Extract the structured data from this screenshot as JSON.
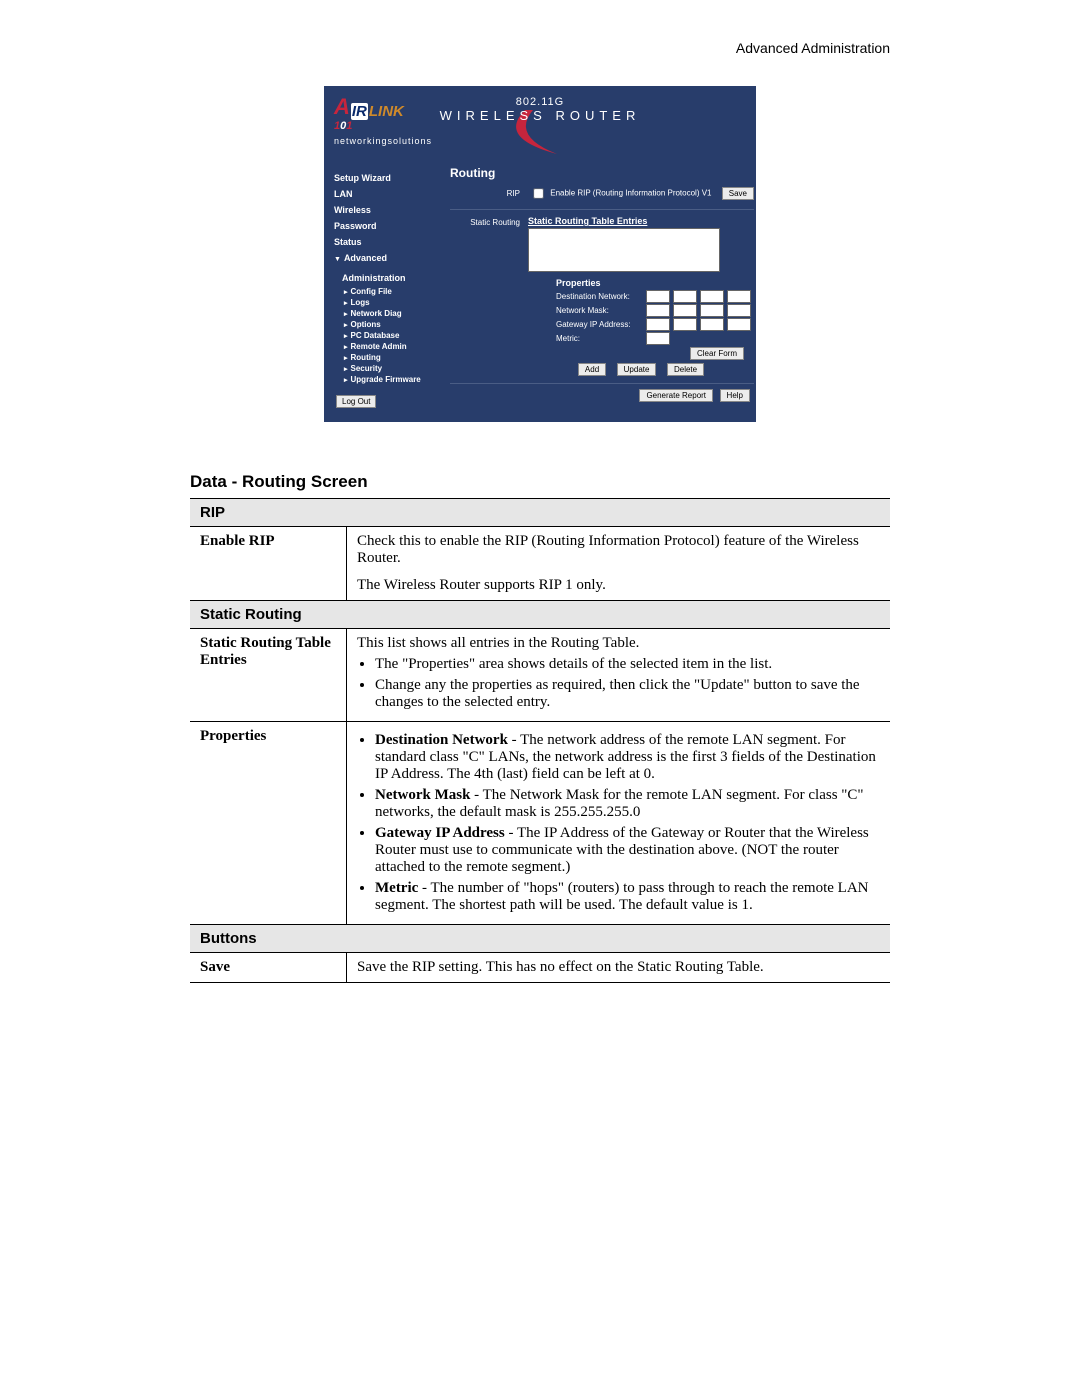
{
  "header": {
    "right": "Advanced Administration"
  },
  "brand": {
    "airlink": "AIRLINK",
    "model": "101",
    "tagline": "networkingsolutions"
  },
  "router_label": {
    "line1": "802.11G",
    "line2": "Wireless Router"
  },
  "nav": {
    "setup_wizard": "Setup Wizard",
    "lan": "LAN",
    "wireless": "Wireless",
    "password": "Password",
    "status": "Status",
    "advanced": "Advanced",
    "administration": "Administration",
    "sub": {
      "config_file": "Config File",
      "logs": "Logs",
      "network_diag": "Network Diag",
      "options": "Options",
      "pc_database": "PC Database",
      "remote_admin": "Remote Admin",
      "routing": "Routing",
      "security": "Security",
      "upgrade_firmware": "Upgrade Firmware"
    },
    "logout": "Log Out"
  },
  "main": {
    "title": "Routing",
    "rip_label": "RIP",
    "rip_cb": "Enable RIP (Routing Information Protocol) V1",
    "save": "Save",
    "sr_label": "Static Routing",
    "sr_entries": "Static Routing Table Entries",
    "properties": "Properties",
    "props": {
      "dest": "Destination Network:",
      "mask": "Network Mask:",
      "gw": "Gateway IP Address:",
      "metric": "Metric:"
    },
    "clear_form": "Clear Form",
    "add": "Add",
    "update": "Update",
    "delete": "Delete",
    "gen_report": "Generate Report",
    "help": "Help"
  },
  "doc": {
    "heading": "Data - Routing Screen",
    "sec_rip": "RIP",
    "row1_label": "Enable RIP",
    "row1_p1": "Check this to enable the RIP (Routing Information Protocol) feature of the Wireless Router.",
    "row1_p2": "The Wireless Router supports RIP 1 only.",
    "sec_sr": "Static Routing",
    "row2_label": "Static Routing Table Entries",
    "row2_p1": "This list shows all entries in the Routing Table.",
    "row2_b1": "The \"Properties\" area shows details of the selected item in the list.",
    "row2_b2": "Change any the properties as required, then click the \"Update\" button to save the changes to the selected entry.",
    "row3_label": "Properties",
    "row3_b1_b": "Destination Network",
    "row3_b1": " - The network address of the remote LAN segment. For standard class \"C\" LANs, the network address is the first 3 fields of the Destination IP Address. The 4th (last) field can be left at 0.",
    "row3_b2_b": "Network Mask",
    "row3_b2": " - The Network Mask for the remote LAN segment. For class \"C\" networks, the default mask is 255.255.255.0",
    "row3_b3_b": "Gateway IP Address",
    "row3_b3": " - The IP Address of the Gateway or Router that the Wireless Router must use to communicate with the destination above. (NOT the router attached to the remote segment.)",
    "row3_b4_b": "Metric",
    "row3_b4": " - The number of \"hops\" (routers) to pass through to reach the remote LAN segment. The shortest path will be used. The default value is 1.",
    "sec_btns": "Buttons",
    "row4_label": "Save",
    "row4_p1": "Save the RIP setting. This has no effect on the Static Routing Table."
  }
}
